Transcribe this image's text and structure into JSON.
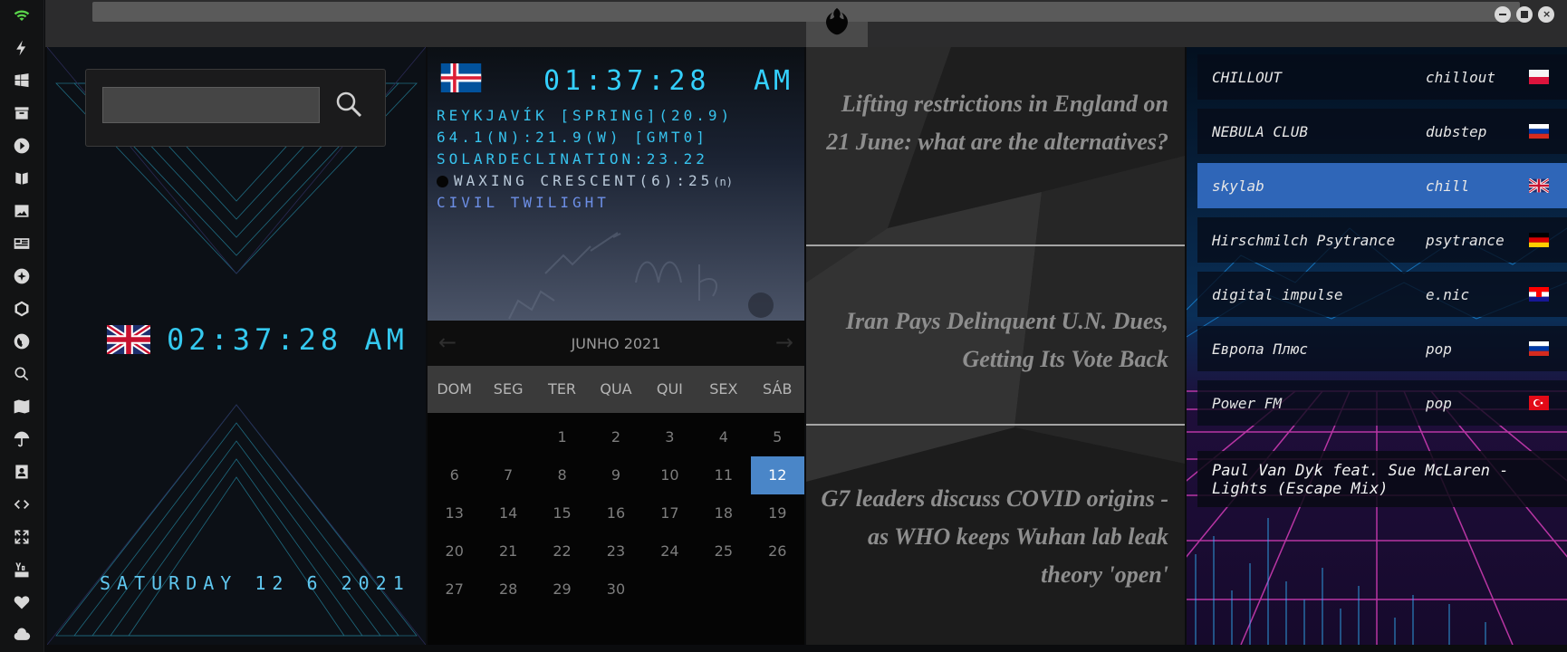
{
  "window": {
    "buttons": [
      "minimize",
      "maximize",
      "close"
    ],
    "accent_color": "#35c9ef"
  },
  "sidebar": {
    "icons": [
      "wifi-icon",
      "lightning-icon",
      "windows-icon",
      "archive-icon",
      "play-icon",
      "book-icon",
      "image-icon",
      "news-icon",
      "sun-icon",
      "hexagon-icon",
      "globe-icon",
      "search-icon",
      "map-icon",
      "umbrella-icon",
      "contact-icon",
      "code-icon",
      "expand-icon",
      "youtube-icon",
      "heart-icon",
      "cloud-icon"
    ]
  },
  "local_clock": {
    "time": "02:37:28 AM",
    "date": "SATURDAY 12 6 2021",
    "search_placeholder": ""
  },
  "astro": {
    "time": "01:37:28",
    "ampm": "AM",
    "line1": "REYKJAVÍK [SPRING](20.9)",
    "line2": "64.1(N):21.9(W) [GMT0]",
    "line3": "SOLARDECLINATION:23.22",
    "line4": "WAXING CRESCENT(6):25",
    "line4_suffix": "(n)",
    "line5": "CIVIL TWILIGHT"
  },
  "calendar": {
    "title": "JUNHO 2021",
    "prev": "←",
    "next": "→",
    "weekdays": [
      "DOM",
      "SEG",
      "TER",
      "QUA",
      "QUI",
      "SEX",
      "SÁB"
    ],
    "weeks": [
      [
        "",
        "",
        "1",
        "2",
        "3",
        "4",
        "5"
      ],
      [
        "6",
        "7",
        "8",
        "9",
        "10",
        "11",
        "12"
      ],
      [
        "13",
        "14",
        "15",
        "16",
        "17",
        "18",
        "19"
      ],
      [
        "20",
        "21",
        "22",
        "23",
        "24",
        "25",
        "26"
      ],
      [
        "27",
        "28",
        "29",
        "30",
        "",
        "",
        ""
      ]
    ],
    "today": "12"
  },
  "news": [
    "Lifting restrictions in England on 21 June: what are the alternatives?",
    "Iran Pays Delinquent U.N. Dues, Getting Its Vote Back",
    "G7 leaders discuss COVID origins - as WHO keeps Wuhan lab leak theory 'open'"
  ],
  "radio": {
    "stations": [
      {
        "name": "CHILLOUT",
        "genre": "chillout",
        "flag": "poland-flag-icon"
      },
      {
        "name": "NEBULA CLUB",
        "genre": "dubstep",
        "flag": "russia-flag-icon"
      },
      {
        "name": "skylab",
        "genre": "chill",
        "flag": "uk-flag-icon",
        "active": true
      },
      {
        "name": "Hirschmilch Psytrance",
        "genre": "psytrance",
        "flag": "germany-flag-icon"
      },
      {
        "name": "digital impulse",
        "genre": "e.nic",
        "flag": "croatia-flag-icon"
      },
      {
        "name": "Европа Плюс",
        "genre": "pop",
        "flag": "russia-flag-icon"
      },
      {
        "name": "Power FM",
        "genre": "pop",
        "flag": "turkey-flag-icon"
      }
    ],
    "now_playing": "Paul Van Dyk feat. Sue McLaren - Lights (Escape Mix)",
    "active_color": "#2f66b8"
  }
}
